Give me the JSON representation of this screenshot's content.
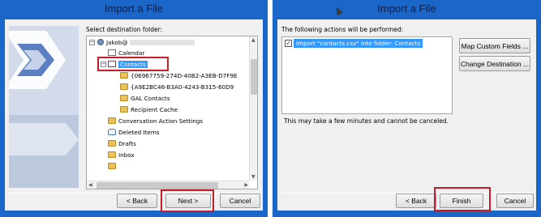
{
  "left_window": {
    "title": "Import a File",
    "destination_label": "Select destination folder:",
    "tree": {
      "account": "Jakob@",
      "items": [
        {
          "label": "Calendar",
          "icon": "calendar-icon"
        },
        {
          "label": "Contacts",
          "icon": "contacts-icon",
          "selected": true
        },
        {
          "label": "{06967759-274D-40B2-A3EB-D7F9E",
          "icon": "folder-icon"
        },
        {
          "label": "{A9E2BC46-B3A0-4243-B315-60D9",
          "icon": "folder-icon"
        },
        {
          "label": "GAL Contacts",
          "icon": "folder-icon"
        },
        {
          "label": "Recipient Cache",
          "icon": "folder-icon"
        },
        {
          "label": "Conversation Action Settings",
          "icon": "folder-icon"
        },
        {
          "label": "Deleted Items",
          "icon": "deleted-items-icon"
        },
        {
          "label": "Drafts",
          "icon": "folder-icon"
        },
        {
          "label": "Inbox",
          "icon": "folder-icon"
        }
      ]
    },
    "buttons": {
      "back": "< Back",
      "next": "Next >",
      "cancel": "Cancel"
    }
  },
  "right_window": {
    "title": "Import a File",
    "actions_label": "The following actions will be performed:",
    "action_item": "Import \"contacts.csv\" into folder: Contacts",
    "action_checked": true,
    "map_button": "Map Custom Fields ...",
    "change_button": "Change Destination ...",
    "notice": "This may take a few minutes and cannot be canceled.",
    "buttons": {
      "back": "< Back",
      "finish": "Finish",
      "cancel": "Cancel"
    }
  },
  "colors": {
    "title_bar": "#1a66c9",
    "selection": "#3399ff",
    "highlight_box": "#c21f2b"
  }
}
